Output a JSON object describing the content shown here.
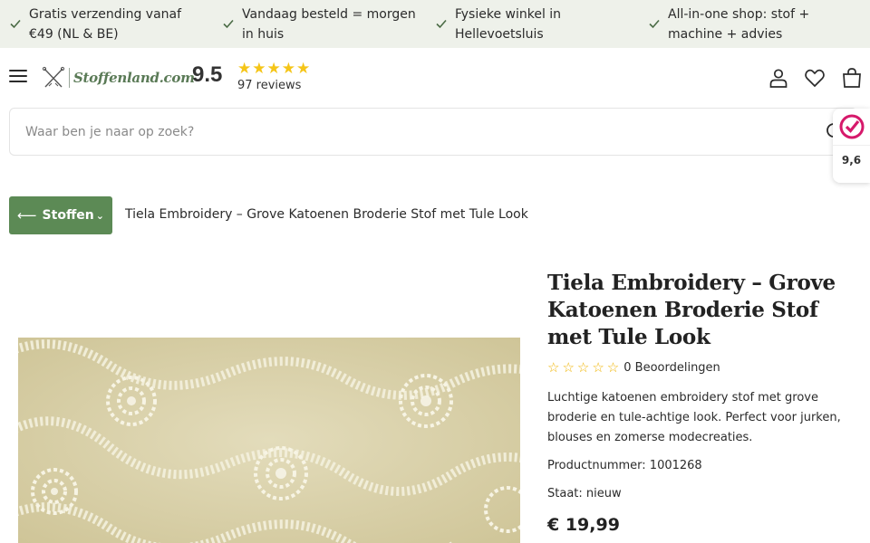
{
  "usp": [
    {
      "text": "Gratis verzending vanaf €49 (NL & BE)",
      "icon": "check-icon"
    },
    {
      "text": "Vandaag besteld = morgen in huis",
      "icon": "check-icon"
    },
    {
      "text": "Fysieke winkel in Hellevoetsluis",
      "icon": "check-icon"
    },
    {
      "text": "All-in-one shop: stof + machine + advies",
      "icon": "check-icon"
    }
  ],
  "header": {
    "logo_text": "Stoffenland.com",
    "score": "9.5",
    "stars": "★★★★★",
    "reviews": "97 reviews"
  },
  "search": {
    "placeholder": "Waar ben je naar op zoek?"
  },
  "badge": {
    "rating": "9,6"
  },
  "breadcrumb": {
    "back_label": "Stoffen",
    "current": "Tiela Embroidery – Grove Katoenen Broderie Stof met Tule Look"
  },
  "product": {
    "title": "Tiela Embroidery – Grove Katoenen Broderie Stof met Tule Look",
    "stars": "☆☆☆☆☆",
    "rating_count": "0 Beoordelingen",
    "description": "Luchtige katoenen embroidery stof met grove broderie en tule-achtige look. Perfect voor jurken, blouses en zomerse modecreaties.",
    "product_number": "Productnummer: 1001268",
    "condition": "Staat: nieuw",
    "price": "€ 19,99"
  },
  "colors": {
    "brand_green": "#5c8a55",
    "usp_bg": "#eef1ea",
    "star": "#f5c518"
  }
}
